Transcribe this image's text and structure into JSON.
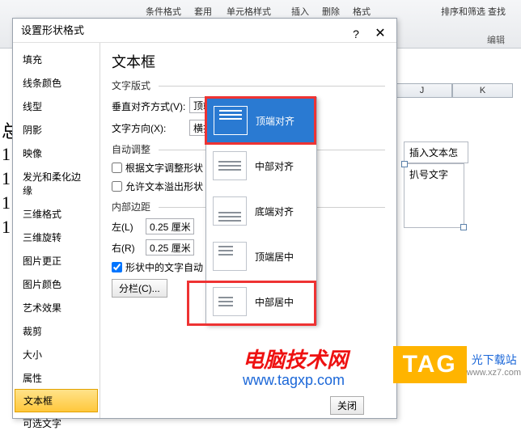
{
  "ribbon": {
    "items": [
      "条件格式",
      "套用",
      "单元格样式",
      "插入",
      "删除",
      "格式",
      "排序和筛选 查找"
    ],
    "edit_group": "编辑"
  },
  "sheet": {
    "cols": [
      "J",
      "K"
    ],
    "textbox1": "插入文本怎",
    "textbox2": "扒号文字",
    "side_chars": [
      "总",
      "1",
      "1",
      "1",
      "1"
    ]
  },
  "dialog": {
    "title": "设置形状格式",
    "sidebar": [
      "填充",
      "线条颜色",
      "线型",
      "阴影",
      "映像",
      "发光和柔化边缘",
      "三维格式",
      "三维旋转",
      "图片更正",
      "图片颜色",
      "艺术效果",
      "裁剪",
      "大小",
      "属性",
      "文本框",
      "可选文字"
    ],
    "content": {
      "heading": "文本框",
      "sec1": "文字版式",
      "valign_label": "垂直对齐方式(V):",
      "valign_value": "顶端对齐",
      "dir_label": "文字方向(X):",
      "dir_value": "横排",
      "sec2": "自动调整",
      "chk1": "根据文字调整形状",
      "chk2": "允许文本溢出形状",
      "sec3": "内部边距",
      "left_label": "左(L)",
      "right_label": "右(R)",
      "margin_value": "0.25 厘米",
      "chk3": "形状中的文字自动",
      "col_btn": "分栏(C)..."
    },
    "footer": {
      "close": "关闭"
    }
  },
  "menu": {
    "items": [
      "顶端对齐",
      "中部对齐",
      "底端对齐",
      "顶端居中",
      "中部居中"
    ]
  },
  "watermark": {
    "text1": "电脑技术网",
    "text2": "www.tagxp.com",
    "tag": "TAG",
    "tag_text": "光下载站",
    "tag_sub": "www.xz7.com"
  }
}
